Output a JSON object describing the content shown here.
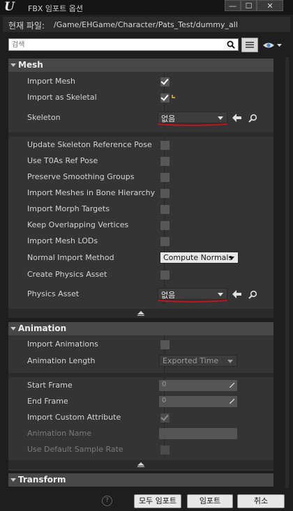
{
  "window": {
    "title": "FBX 임포트 옵션",
    "buttons": {
      "minimize": "—",
      "maximize": "☐",
      "close": "✕"
    }
  },
  "path": {
    "label": "현재 파일:",
    "value": "/Game/EHGame/Character/Pats_Test/dummy_all"
  },
  "search": {
    "placeholder": "검색"
  },
  "mesh": {
    "header": "Mesh",
    "import_mesh": {
      "label": "Import Mesh",
      "checked": true
    },
    "import_as_skeletal": {
      "label": "Import as Skeletal",
      "checked": true
    },
    "skeleton": {
      "label": "Skeleton",
      "value": "없음"
    },
    "advanced": [
      {
        "label": "Update Skeleton Reference Pose",
        "checked": false
      },
      {
        "label": "Use T0As Ref Pose",
        "checked": false
      },
      {
        "label": "Preserve Smoothing Groups",
        "checked": false
      },
      {
        "label": "Import Meshes in Bone Hierarchy",
        "checked": false
      },
      {
        "label": "Import Morph Targets",
        "checked": false
      },
      {
        "label": "Keep Overlapping Vertices",
        "checked": false
      },
      {
        "label": "Import Mesh LODs",
        "checked": false
      }
    ],
    "normal_import_method": {
      "label": "Normal Import Method",
      "value": "Compute Normals"
    },
    "create_physics_asset": {
      "label": "Create Physics Asset",
      "checked": false
    },
    "physics_asset": {
      "label": "Physics Asset",
      "value": "없음"
    }
  },
  "animation": {
    "header": "Animation",
    "import_animations": {
      "label": "Import Animations",
      "checked": false
    },
    "animation_length": {
      "label": "Animation Length",
      "value": "Exported Time"
    },
    "start_frame": {
      "label": "Start Frame",
      "value": "0"
    },
    "end_frame": {
      "label": "End Frame",
      "value": "0"
    },
    "import_custom_attribute": {
      "label": "Import Custom Attribute",
      "checked": true
    },
    "animation_name": {
      "label": "Animation Name",
      "value": ""
    },
    "use_default_sample_rate": {
      "label": "Use Default Sample Rate",
      "checked": false
    }
  },
  "transform": {
    "header": "Transform"
  },
  "footer": {
    "help": "?",
    "import_all": "모두 임포트",
    "import": "임포트",
    "cancel": "취소"
  },
  "colors": {
    "annotation_red": "#d0101a",
    "background": "#1e1e1e",
    "panel": "#343434"
  }
}
